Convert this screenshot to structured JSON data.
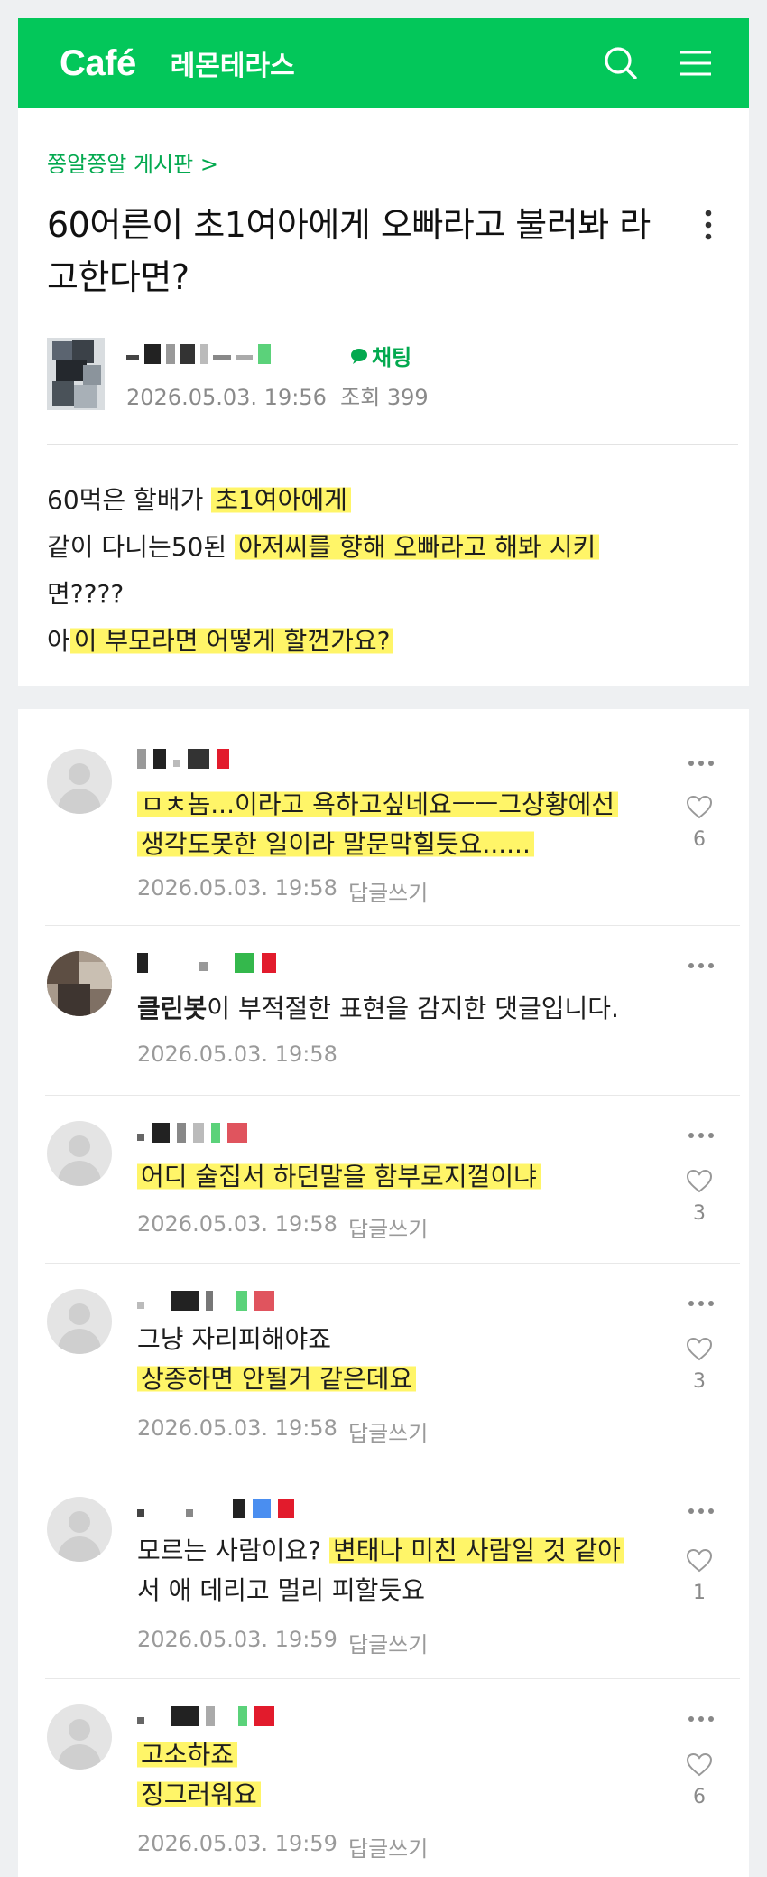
{
  "header": {
    "logo": "Café",
    "cafe_name": "레몬테라스",
    "brand_color": "#03c75a",
    "icons": [
      "search-icon",
      "menu-icon"
    ]
  },
  "article": {
    "board_link": "쫑알쫑알 게시판 >",
    "title": "60어른이 초1여아에게 오빠라고 불러봐 라고한다면?",
    "chat_label": "채팅",
    "date": "2026.05.03. 19:56",
    "views": "조회 399",
    "body": {
      "line1_a": "60먹은 할배가 ",
      "line1_b": "초1여아에게",
      "line2_a": "같이 다니는50된 ",
      "line2_b": "아저씨를 향해 오빠라고 해봐 시키",
      "line3": "면????",
      "line4_a": "아",
      "line4_b": "이 부모라면 어떻게 할껀가요?"
    }
  },
  "comments": [
    {
      "text_a": "ㅁㅊ놈...이라고 욕하고싶네요ㅡㅡ그상황에선",
      "text_b": "생각도못한 일이라 말문막힐듯요......",
      "date": "2026.05.03. 19:58",
      "reply": "답글쓰기",
      "likes": "6"
    },
    {
      "text_bold": "클린봇",
      "text_rest": "이 부적절한 표현을 감지한 댓글입니다.",
      "date": "2026.05.03. 19:58"
    },
    {
      "text_a": "어디 술집서 하던말을 함부로지껄이냐",
      "date": "2026.05.03. 19:58",
      "reply": "답글쓰기",
      "likes": "3"
    },
    {
      "text_a": "그냥 자리피해야죠",
      "text_b": "상종하면 안될거 같은데요",
      "date": "2026.05.03. 19:58",
      "reply": "답글쓰기",
      "likes": "3"
    },
    {
      "text_a1": "모르는 사람이요? ",
      "text_a2": "변태나 미친 사람일 것 같아",
      "text_b": "서 애 데리고 멀리 피할듯요",
      "date": "2026.05.03. 19:59",
      "reply": "답글쓰기",
      "likes": "1"
    },
    {
      "text_a": "고소하죠",
      "text_b": "징그러워요",
      "date": "2026.05.03. 19:59",
      "reply": "답글쓰기",
      "likes": "6"
    }
  ]
}
